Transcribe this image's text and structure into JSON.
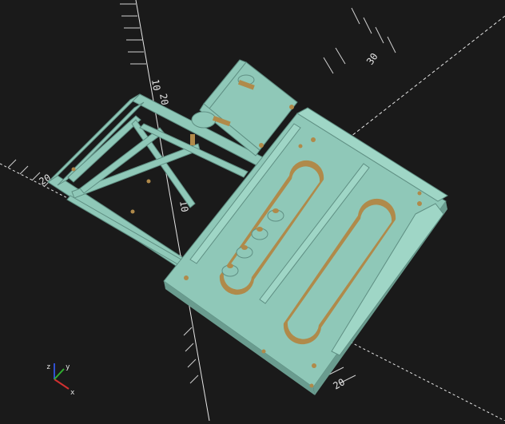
{
  "viewport": {
    "background": "#1a1a1a",
    "model_color": "#8fc8b8",
    "model_shadow": "#6a9c8f",
    "hole_color": "#b08a4a",
    "axis_color": "#e6e6e6",
    "axis_tick_labels": [
      "10",
      "20",
      "30",
      "20",
      "10",
      "20"
    ],
    "gizmo": {
      "x_label": "x",
      "y_label": "y",
      "z_label": "z",
      "x_color": "#d03030",
      "y_color": "#30b030",
      "z_color": "#3050d0"
    }
  },
  "objects": [
    {
      "name": "lattice-frame"
    },
    {
      "name": "motor-bracket"
    },
    {
      "name": "base-plate"
    }
  ]
}
